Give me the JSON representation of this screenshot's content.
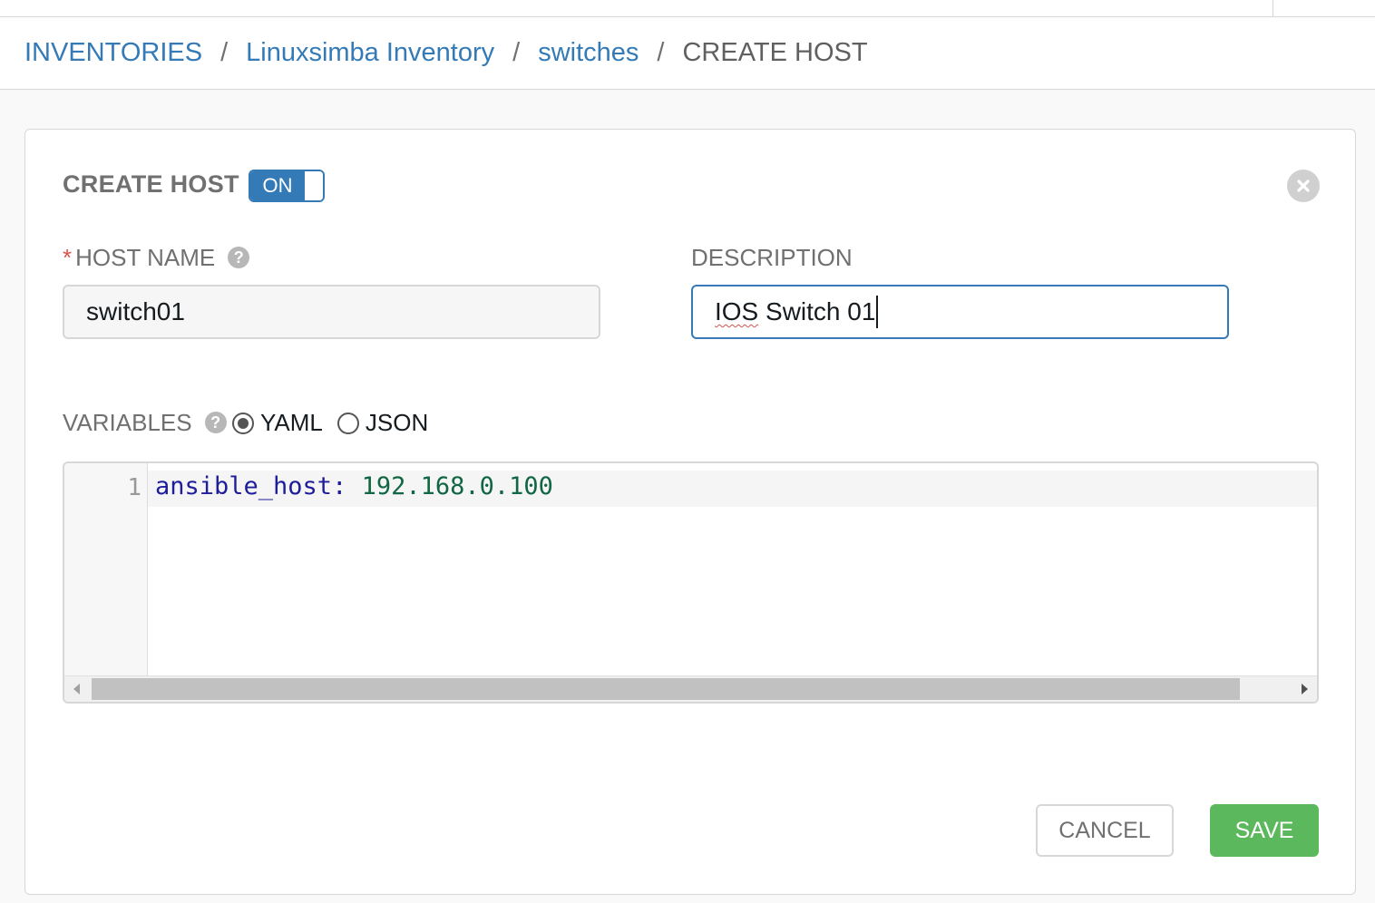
{
  "breadcrumb": {
    "items": [
      "INVENTORIES",
      "Linuxsimba Inventory",
      "switches"
    ],
    "separator": "/",
    "current": "CREATE HOST"
  },
  "panel": {
    "title": "CREATE HOST",
    "toggle_label": "ON",
    "close_icon": "close-circle-icon"
  },
  "form": {
    "host_name": {
      "label": "HOST NAME",
      "required_mark": "*",
      "value": "switch01",
      "help": "?"
    },
    "description": {
      "label": "DESCRIPTION",
      "value_misspelled": "IOS",
      "value_rest": " Switch 01"
    },
    "variables": {
      "label": "VARIABLES",
      "help": "?",
      "formats": [
        "YAML",
        "JSON"
      ],
      "selected_format": "YAML",
      "line_number": "1",
      "code_key": "ansible_host",
      "code_colon": ":",
      "code_value": "192.168.0.100"
    }
  },
  "actions": {
    "cancel_label": "CANCEL",
    "save_label": "SAVE"
  },
  "colors": {
    "link": "#337ab7",
    "save": "#5cb85c",
    "required": "#d9534f",
    "focus": "#337ab7"
  }
}
